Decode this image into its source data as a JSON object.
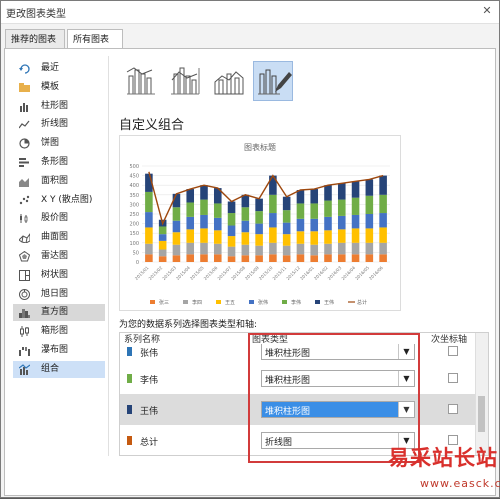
{
  "window": {
    "title": "更改图表类型",
    "close_glyph": "✕"
  },
  "tabs": [
    {
      "label": "推荐的图表",
      "active": false
    },
    {
      "label": "所有图表",
      "active": true
    }
  ],
  "sidebar": {
    "items": [
      {
        "label": "最近",
        "icon": "recent-icon"
      },
      {
        "label": "模板",
        "icon": "folder-icon"
      },
      {
        "label": "柱形图",
        "icon": "column-chart-icon"
      },
      {
        "label": "折线图",
        "icon": "line-chart-icon"
      },
      {
        "label": "饼图",
        "icon": "pie-chart-icon"
      },
      {
        "label": "条形图",
        "icon": "bar-chart-icon"
      },
      {
        "label": "面积图",
        "icon": "area-chart-icon"
      },
      {
        "label": "X Y (散点图)",
        "icon": "scatter-chart-icon"
      },
      {
        "label": "股价图",
        "icon": "stock-chart-icon"
      },
      {
        "label": "曲面图",
        "icon": "surface-chart-icon"
      },
      {
        "label": "雷达图",
        "icon": "radar-chart-icon"
      },
      {
        "label": "树状图",
        "icon": "treemap-icon"
      },
      {
        "label": "旭日图",
        "icon": "sunburst-icon"
      },
      {
        "label": "直方图",
        "icon": "histogram-icon"
      },
      {
        "label": "箱形图",
        "icon": "box-whisker-icon"
      },
      {
        "label": "瀑布图",
        "icon": "waterfall-icon"
      },
      {
        "label": "组合",
        "icon": "combo-chart-icon"
      }
    ],
    "selected_index": 16,
    "highlighted_index": 13
  },
  "combo": {
    "section_title": "自定义组合",
    "prompt": "为您的数据系列选择图表类型和轴:",
    "headers": {
      "series_name": "系列名称",
      "chart_type": "图表类型",
      "secondary_axis": "次坐标轴"
    },
    "rows": [
      {
        "name": "张伟",
        "color": "#2e75b6",
        "type": "堆积柱形图",
        "selected": false,
        "partial": true
      },
      {
        "name": "李伟",
        "color": "#70ad47",
        "type": "堆积柱形图",
        "selected": false,
        "partial": false
      },
      {
        "name": "王伟",
        "color": "#264478",
        "type": "堆积柱形图",
        "selected": true,
        "partial": false
      },
      {
        "name": "总计",
        "color": "#c55a11",
        "type": "折线图",
        "selected": false,
        "partial": false
      }
    ]
  },
  "watermark": {
    "title": "易采站长站",
    "url": "www.easck.com"
  },
  "chart_data": {
    "type": "bar",
    "title": "图表标题",
    "categories": [
      "2015/01",
      "2015/02",
      "2015/03",
      "2015/04",
      "2015/05",
      "2015/06",
      "2015/07",
      "2015/08",
      "2015/09",
      "2015/10",
      "2015/11",
      "2015/12",
      "2016/01",
      "2016/02",
      "2016/03",
      "2016/04",
      "2016/05",
      "2016/06"
    ],
    "ylim": [
      0,
      500
    ],
    "yticks": [
      "0",
      "50",
      "100",
      "150",
      "200",
      "250",
      "300",
      "350",
      "400",
      "450",
      "500"
    ],
    "series": [
      {
        "name": "张三",
        "color": "#ed7d31",
        "values": [
          40,
          30,
          35,
          40,
          40,
          40,
          30,
          35,
          35,
          40,
          35,
          40,
          35,
          40,
          40,
          40,
          40,
          40
        ]
      },
      {
        "name": "李四",
        "color": "#a5a5a5",
        "values": [
          55,
          35,
          55,
          60,
          60,
          55,
          50,
          55,
          50,
          60,
          50,
          55,
          55,
          55,
          60,
          60,
          60,
          60
        ]
      },
      {
        "name": "王五",
        "color": "#ffc000",
        "values": [
          85,
          45,
          65,
          70,
          75,
          70,
          55,
          65,
          60,
          80,
          60,
          65,
          70,
          70,
          70,
          75,
          75,
          80
        ]
      },
      {
        "name": "张伟",
        "color": "#4472c4",
        "values": [
          80,
          35,
          60,
          65,
          70,
          65,
          55,
          60,
          55,
          75,
          60,
          65,
          65,
          70,
          70,
          70,
          75,
          75
        ]
      },
      {
        "name": "李伟",
        "color": "#70ad47",
        "values": [
          105,
          40,
          70,
          75,
          80,
          75,
          65,
          70,
          65,
          95,
          65,
          80,
          80,
          85,
          85,
          90,
          95,
          95
        ]
      },
      {
        "name": "王伟",
        "color": "#264478",
        "values": [
          95,
          35,
          70,
          70,
          75,
          80,
          60,
          65,
          65,
          100,
          70,
          70,
          75,
          80,
          85,
          85,
          85,
          100
        ]
      },
      {
        "name": "总计",
        "color": "#9e480e",
        "type": "line",
        "values": [
          470,
          200,
          355,
          380,
          400,
          385,
          315,
          350,
          330,
          450,
          340,
          375,
          380,
          400,
          410,
          420,
          430,
          450
        ]
      }
    ]
  }
}
